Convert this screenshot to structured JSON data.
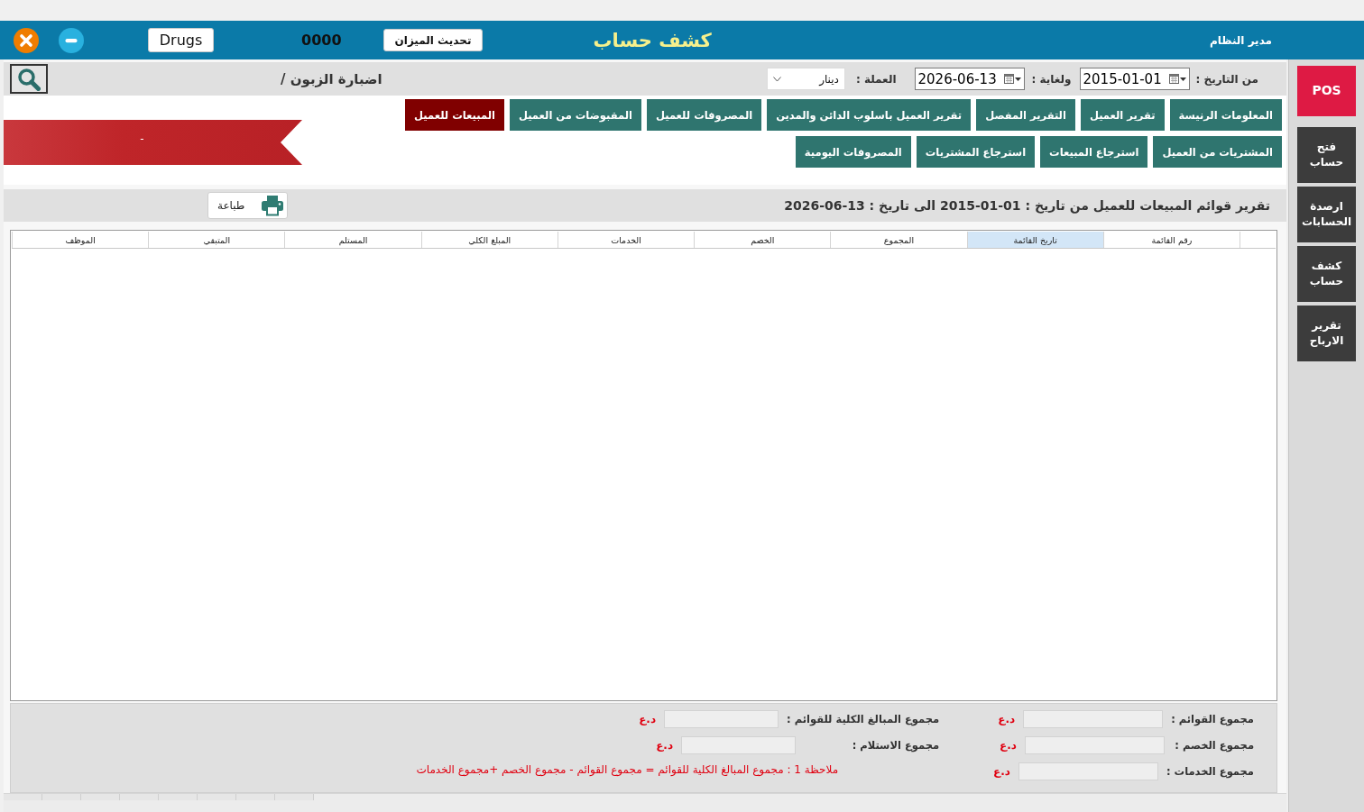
{
  "window": {
    "title": "كشف حساب",
    "user": "مدير النظام",
    "database_button": "Drugs",
    "scale_reading": "0000",
    "scale_button": "تحديث الميزان"
  },
  "filters": {
    "from_label": "من التاريخ :",
    "from_date": "2015-01-01",
    "to_label": "ولغاية :",
    "to_date": "2026-06-13",
    "currency_label": "العملة :",
    "currency": "دينار",
    "breadcrumb": "اضبارة الزبون /"
  },
  "report_buttons": [
    [
      {
        "label": "المعلومات الرنيسة",
        "selected": false
      },
      {
        "label": "تقرير العميل",
        "selected": false
      },
      {
        "label": "التقرير المفصل",
        "selected": false
      },
      {
        "label": "تقرير العميل باسلوب الدائن والمدين",
        "selected": false
      },
      {
        "label": "المصروفات للعميل",
        "selected": false
      },
      {
        "label": "المقبوضات من العميل",
        "selected": false
      },
      {
        "label": "المبيعات للعميل",
        "selected": true
      }
    ],
    [
      {
        "label": "المشتريات من العميل",
        "selected": false
      },
      {
        "label": "استرجاع المبيعات",
        "selected": false
      },
      {
        "label": "استرجاع المشتريات",
        "selected": false
      },
      {
        "label": "المصروفات اليومية",
        "selected": false
      }
    ]
  ],
  "ribbon": {
    "text": "-"
  },
  "report": {
    "title": "تقرير قوائم المبيعات للعميل من تاريخ : 01-01-2015 الى تاريخ : 13-06-2026",
    "print_button": "طباعة"
  },
  "table": {
    "columns": [
      {
        "label": "رقم القائمة",
        "selected": false
      },
      {
        "label": "تاريخ القائمة",
        "selected": true
      },
      {
        "label": "المجموع",
        "selected": false
      },
      {
        "label": "الخصم",
        "selected": false
      },
      {
        "label": "الخدمات",
        "selected": false
      },
      {
        "label": "المبلغ الكلي",
        "selected": false
      },
      {
        "label": "المستلم",
        "selected": false
      },
      {
        "label": "المتبقي",
        "selected": false
      },
      {
        "label": "الموظف",
        "selected": false
      }
    ]
  },
  "summary": {
    "columns": [
      {
        "fields": [
          {
            "label": "مجموع القوائم :",
            "unit": "د.ع"
          },
          {
            "label": "مجموع الخصم :",
            "unit": "د.ع"
          },
          {
            "label": "مجموع الخدمات :",
            "unit": "د.ع"
          }
        ]
      },
      {
        "fields": [
          {
            "label": "مجموع المبالغ الكلية للقوائم :",
            "unit": "د.ع"
          },
          {
            "label": "مجموع الاستلام :",
            "unit": "د.ع"
          }
        ]
      }
    ],
    "note": "ملاحظة 1 : مجموع المبالغ الكلية للقوائم = مجموع القوائم - مجموع الخصم +مجموع الخدمات"
  },
  "sidebar": {
    "items": [
      {
        "label": "POS",
        "kind": "accent"
      },
      {
        "label": "فتح حساب",
        "kind": "dark"
      },
      {
        "label": "ارصدة الحسابات",
        "kind": "dark"
      },
      {
        "label": "كشف حساب",
        "kind": "dark"
      },
      {
        "label": "تقرير الارباح",
        "kind": "dark"
      }
    ]
  }
}
